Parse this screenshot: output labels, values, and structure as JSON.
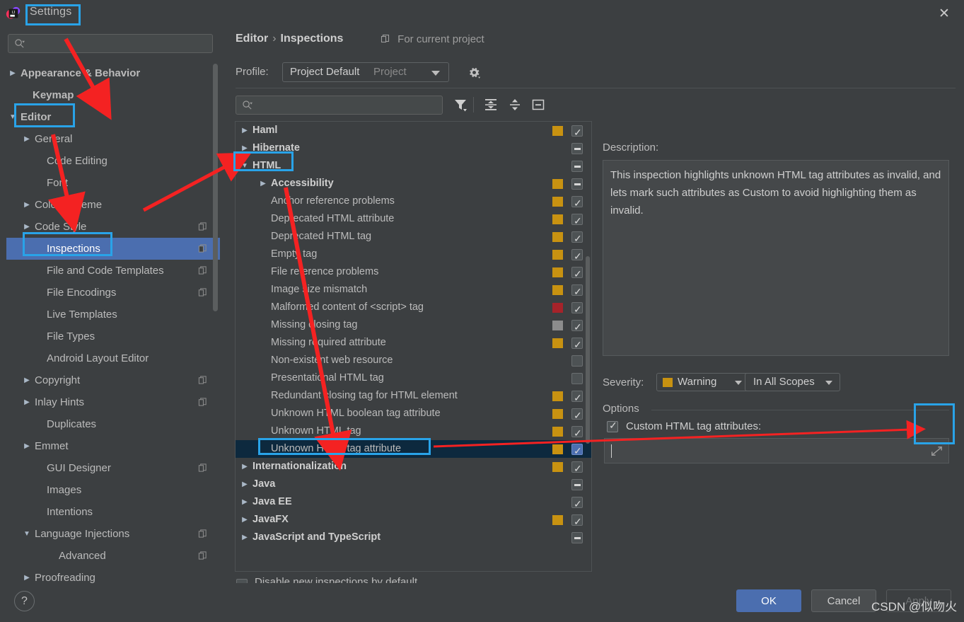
{
  "window": {
    "title": "Settings",
    "close_icon": "close-icon",
    "app_icon": "intellij-idea-logo"
  },
  "sidebar": {
    "search_placeholder": "",
    "items": [
      {
        "label": "Appearance & Behavior",
        "arrow": "right",
        "indent": 20,
        "copy": false,
        "bold": true,
        "selected": false
      },
      {
        "label": "Keymap",
        "arrow": "none",
        "indent": 37,
        "copy": false,
        "bold": true,
        "selected": false
      },
      {
        "label": "Editor",
        "arrow": "down",
        "indent": 20,
        "copy": false,
        "bold": true,
        "selected": false
      },
      {
        "label": "General",
        "arrow": "right",
        "indent": 40,
        "copy": false,
        "bold": false,
        "selected": false
      },
      {
        "label": "Code Editing",
        "arrow": "none",
        "indent": 57,
        "copy": false,
        "bold": false,
        "selected": false
      },
      {
        "label": "Font",
        "arrow": "none",
        "indent": 57,
        "copy": false,
        "bold": false,
        "selected": false
      },
      {
        "label": "Color Scheme",
        "arrow": "right",
        "indent": 40,
        "copy": false,
        "bold": false,
        "selected": false
      },
      {
        "label": "Code Style",
        "arrow": "right",
        "indent": 40,
        "copy": true,
        "bold": false,
        "selected": false
      },
      {
        "label": "Inspections",
        "arrow": "none",
        "indent": 57,
        "copy": true,
        "bold": false,
        "selected": true
      },
      {
        "label": "File and Code Templates",
        "arrow": "none",
        "indent": 57,
        "copy": true,
        "bold": false,
        "selected": false
      },
      {
        "label": "File Encodings",
        "arrow": "none",
        "indent": 57,
        "copy": true,
        "bold": false,
        "selected": false
      },
      {
        "label": "Live Templates",
        "arrow": "none",
        "indent": 57,
        "copy": false,
        "bold": false,
        "selected": false
      },
      {
        "label": "File Types",
        "arrow": "none",
        "indent": 57,
        "copy": false,
        "bold": false,
        "selected": false
      },
      {
        "label": "Android Layout Editor",
        "arrow": "none",
        "indent": 57,
        "copy": false,
        "bold": false,
        "selected": false
      },
      {
        "label": "Copyright",
        "arrow": "right",
        "indent": 40,
        "copy": true,
        "bold": false,
        "selected": false
      },
      {
        "label": "Inlay Hints",
        "arrow": "right",
        "indent": 40,
        "copy": true,
        "bold": false,
        "selected": false
      },
      {
        "label": "Duplicates",
        "arrow": "none",
        "indent": 57,
        "copy": false,
        "bold": false,
        "selected": false
      },
      {
        "label": "Emmet",
        "arrow": "right",
        "indent": 40,
        "copy": false,
        "bold": false,
        "selected": false
      },
      {
        "label": "GUI Designer",
        "arrow": "none",
        "indent": 57,
        "copy": true,
        "bold": false,
        "selected": false
      },
      {
        "label": "Images",
        "arrow": "none",
        "indent": 57,
        "copy": false,
        "bold": false,
        "selected": false
      },
      {
        "label": "Intentions",
        "arrow": "none",
        "indent": 57,
        "copy": false,
        "bold": false,
        "selected": false
      },
      {
        "label": "Language Injections",
        "arrow": "down",
        "indent": 40,
        "copy": true,
        "bold": false,
        "selected": false
      },
      {
        "label": "Advanced",
        "arrow": "none",
        "indent": 74,
        "copy": true,
        "bold": false,
        "selected": false
      },
      {
        "label": "Proofreading",
        "arrow": "right",
        "indent": 40,
        "copy": false,
        "bold": false,
        "selected": false
      }
    ]
  },
  "main": {
    "breadcrumb_parent": "Editor",
    "breadcrumb_sep": "›",
    "breadcrumb_current": "Inspections",
    "for_current_project": "For current project",
    "profile_label": "Profile:",
    "profile_value": "Project Default",
    "profile_scope": "Project",
    "gear_icon": "gear-icon",
    "search_placeholder": "",
    "toolbar": [
      {
        "name": "filter-icon",
        "title": "Filter"
      },
      {
        "name": "expand-all-icon",
        "title": "Expand All"
      },
      {
        "name": "collapse-all-icon",
        "title": "Collapse All"
      },
      {
        "name": "collapse-panel-icon",
        "title": "Collapse"
      }
    ],
    "disable_new_inspections": "Disable new inspections by default"
  },
  "inspections": [
    {
      "label": "Haml",
      "level": 0,
      "arrow": "right",
      "group": true,
      "swatch": "#c89211",
      "check": "checked"
    },
    {
      "label": "Hibernate",
      "level": 0,
      "arrow": "right",
      "group": true,
      "swatch": null,
      "check": "partial"
    },
    {
      "label": "HTML",
      "level": 0,
      "arrow": "down",
      "group": true,
      "swatch": null,
      "check": "partial"
    },
    {
      "label": "Accessibility",
      "level": 1,
      "arrow": "right",
      "group": true,
      "swatch": "#c89211",
      "check": "partial"
    },
    {
      "label": "Anchor reference problems",
      "level": 1,
      "arrow": "none",
      "group": false,
      "swatch": "#c89211",
      "check": "checked"
    },
    {
      "label": "Deprecated HTML attribute",
      "level": 1,
      "arrow": "none",
      "group": false,
      "swatch": "#c89211",
      "check": "checked"
    },
    {
      "label": "Deprecated HTML tag",
      "level": 1,
      "arrow": "none",
      "group": false,
      "swatch": "#c89211",
      "check": "checked"
    },
    {
      "label": "Empty tag",
      "level": 1,
      "arrow": "none",
      "group": false,
      "swatch": "#c89211",
      "check": "checked"
    },
    {
      "label": "File reference problems",
      "level": 1,
      "arrow": "none",
      "group": false,
      "swatch": "#c89211",
      "check": "checked"
    },
    {
      "label": "Image size mismatch",
      "level": 1,
      "arrow": "none",
      "group": false,
      "swatch": "#c89211",
      "check": "checked"
    },
    {
      "label": "Malformed content of <script> tag",
      "level": 1,
      "arrow": "none",
      "group": false,
      "swatch": "#a6232a",
      "check": "checked"
    },
    {
      "label": "Missing closing tag",
      "level": 1,
      "arrow": "none",
      "group": false,
      "swatch": "#8c8c8c",
      "check": "checked"
    },
    {
      "label": "Missing required attribute",
      "level": 1,
      "arrow": "none",
      "group": false,
      "swatch": "#c89211",
      "check": "checked"
    },
    {
      "label": "Non-existent web resource",
      "level": 1,
      "arrow": "none",
      "group": false,
      "swatch": null,
      "check": "unchecked"
    },
    {
      "label": "Presentational HTML tag",
      "level": 1,
      "arrow": "none",
      "group": false,
      "swatch": null,
      "check": "unchecked"
    },
    {
      "label": "Redundant closing tag for HTML element",
      "level": 1,
      "arrow": "none",
      "group": false,
      "swatch": "#c89211",
      "check": "checked"
    },
    {
      "label": "Unknown HTML boolean tag attribute",
      "level": 1,
      "arrow": "none",
      "group": false,
      "swatch": "#c89211",
      "check": "checked"
    },
    {
      "label": "Unknown HTML tag",
      "level": 1,
      "arrow": "none",
      "group": false,
      "swatch": "#c89211",
      "check": "checked"
    },
    {
      "label": "Unknown HTML tag attribute",
      "level": 1,
      "arrow": "none",
      "group": false,
      "swatch": "#c89211",
      "check": "checked",
      "selected": true
    },
    {
      "label": "Internationalization",
      "level": 0,
      "arrow": "right",
      "group": true,
      "swatch": "#c89211",
      "check": "checked"
    },
    {
      "label": "Java",
      "level": 0,
      "arrow": "right",
      "group": true,
      "swatch": null,
      "check": "partial"
    },
    {
      "label": "Java EE",
      "level": 0,
      "arrow": "right",
      "group": true,
      "swatch": null,
      "check": "checked"
    },
    {
      "label": "JavaFX",
      "level": 0,
      "arrow": "right",
      "group": true,
      "swatch": "#c89211",
      "check": "checked"
    },
    {
      "label": "JavaScript and TypeScript",
      "level": 0,
      "arrow": "right",
      "group": true,
      "swatch": null,
      "check": "partial"
    }
  ],
  "details": {
    "description_label": "Description:",
    "description_text": "This inspection highlights unknown HTML tag attributes as invalid, and lets mark such attributes as Custom to avoid highlighting them as invalid.",
    "severity_label": "Severity:",
    "severity_value": "Warning",
    "severity_color": "#c89211",
    "scope_value": "In All Scopes",
    "options_label": "Options",
    "option_checkbox_label": "Custom HTML tag attributes:",
    "option_field_value": "",
    "expand_icon": "expand-field-icon"
  },
  "footer": {
    "help_label": "?",
    "ok_label": "OK",
    "cancel_label": "Cancel",
    "apply_label": "Apply",
    "watermark": "CSDN @似吻火"
  },
  "colors": {
    "accent_blue": "#4b6eaf",
    "annotation_blue": "#29a3e8",
    "annotation_red": "#f42222",
    "warning_yellow": "#c89211",
    "error_red": "#a6232a",
    "background": "#3c3f41"
  }
}
